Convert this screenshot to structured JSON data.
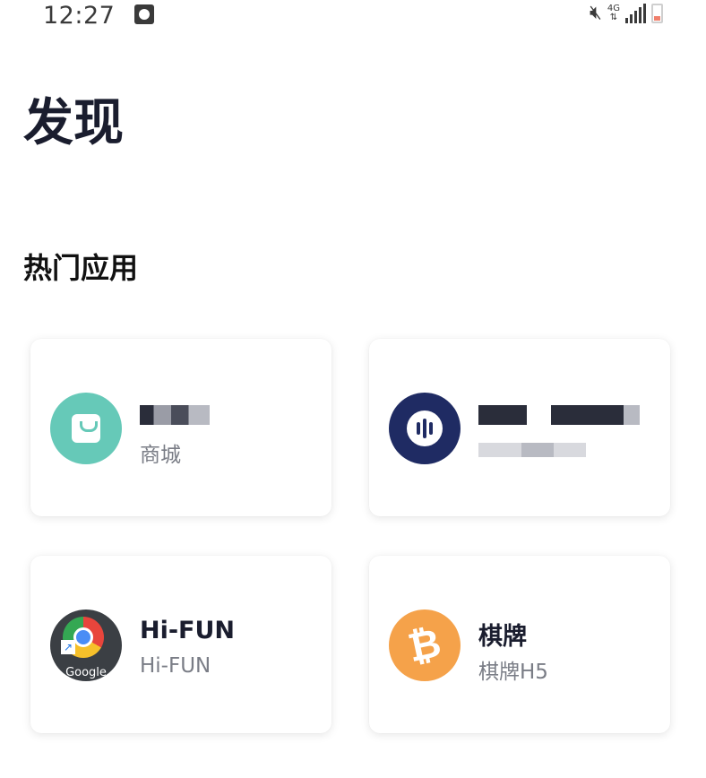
{
  "status_bar": {
    "time": "12:27",
    "network": "4G",
    "icons": [
      "clock-icon",
      "mute-icon",
      "signal-icon",
      "battery-icon"
    ]
  },
  "page": {
    "title": "发现"
  },
  "sections": {
    "hot_apps": {
      "title": "热门应用",
      "cards": [
        {
          "name": "",
          "subtitle": "商城",
          "icon": "shopping-bag-icon",
          "color": "#66c9b8"
        },
        {
          "name": "",
          "subtitle": "",
          "icon": "node-icon",
          "color": "#1f2b63"
        },
        {
          "name": "Hi-FUN",
          "subtitle": "Hi-FUN",
          "icon": "google-chrome-icon",
          "icon_label": "Google"
        },
        {
          "name": "棋牌",
          "subtitle": "棋牌H5",
          "icon": "bitcoin-icon",
          "color": "#f5a24a",
          "icon_glyph": "₿"
        }
      ]
    }
  }
}
